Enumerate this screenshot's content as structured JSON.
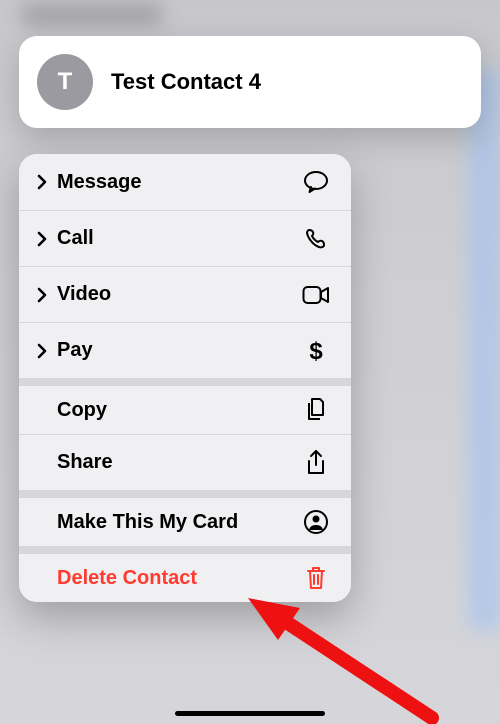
{
  "contact": {
    "initial": "T",
    "name": "Test Contact 4"
  },
  "menu": {
    "message": "Message",
    "call": "Call",
    "video": "Video",
    "pay": "Pay",
    "copy": "Copy",
    "share": "Share",
    "makecard": "Make This My Card",
    "delete": "Delete Contact"
  },
  "colors": {
    "danger": "#ff3b30"
  }
}
